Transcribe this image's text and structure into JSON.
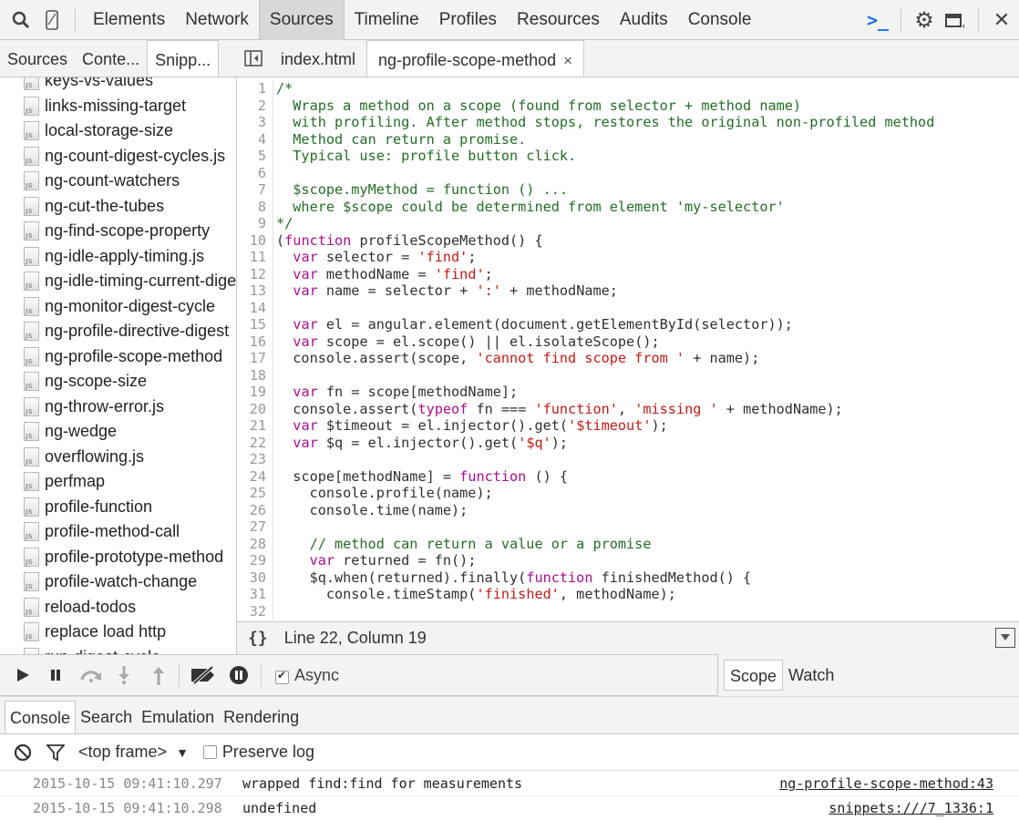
{
  "toolbar": {
    "tabs": [
      "Elements",
      "Network",
      "Sources",
      "Timeline",
      "Profiles",
      "Resources",
      "Audits",
      "Console"
    ],
    "active_tab": "Sources",
    "icons": [
      "search-icon",
      "device-mode-icon",
      "console-prompt-icon",
      "gear-icon",
      "dock-icon",
      "close-icon"
    ]
  },
  "navigator": {
    "tabs": [
      "Sources",
      "Conte...",
      "Snipp..."
    ],
    "active_tab": "Snipp...",
    "files": [
      "keys-vs-values",
      "links-missing-target",
      "local-storage-size",
      "ng-count-digest-cycles.js",
      "ng-count-watchers",
      "ng-cut-the-tubes",
      "ng-find-scope-property",
      "ng-idle-apply-timing.js",
      "ng-idle-timing-current-digest",
      "ng-monitor-digest-cycle",
      "ng-profile-directive-digest",
      "ng-profile-scope-method",
      "ng-scope-size",
      "ng-throw-error.js",
      "ng-wedge",
      "overflowing.js",
      "perfmap",
      "profile-function",
      "profile-method-call",
      "profile-prototype-method",
      "profile-watch-change",
      "reload-todos",
      "replace load http",
      "run-digest-cycle"
    ]
  },
  "editor": {
    "tabs": [
      {
        "label": "index.html",
        "active": false
      },
      {
        "label": "ng-profile-scope-method",
        "active": true,
        "close": "×"
      }
    ],
    "status": "Line 22, Column 19",
    "format_label": "{}",
    "lines": [
      [
        [
          "c",
          "/*"
        ]
      ],
      [
        [
          "c",
          "  Wraps a method on a scope (found from selector + method name)"
        ]
      ],
      [
        [
          "c",
          "  with profiling. After method stops, restores the original non-profiled method"
        ]
      ],
      [
        [
          "c",
          "  Method can return a promise."
        ]
      ],
      [
        [
          "c",
          "  Typical use: profile button click."
        ]
      ],
      [
        [
          "p",
          ""
        ]
      ],
      [
        [
          "c",
          "  $scope.myMethod = function () ..."
        ]
      ],
      [
        [
          "c",
          "  where $scope could be determined from element 'my-selector'"
        ]
      ],
      [
        [
          "c",
          "*/"
        ]
      ],
      [
        [
          "p",
          "("
        ],
        [
          "k",
          "function"
        ],
        [
          "p",
          " profileScopeMethod() {"
        ]
      ],
      [
        [
          "p",
          "  "
        ],
        [
          "k",
          "var"
        ],
        [
          "p",
          " selector = "
        ],
        [
          "s",
          "'find'"
        ],
        [
          "p",
          ";"
        ]
      ],
      [
        [
          "p",
          "  "
        ],
        [
          "k",
          "var"
        ],
        [
          "p",
          " methodName = "
        ],
        [
          "s",
          "'find'"
        ],
        [
          "p",
          ";"
        ]
      ],
      [
        [
          "p",
          "  "
        ],
        [
          "k",
          "var"
        ],
        [
          "p",
          " name = selector + "
        ],
        [
          "s",
          "':'"
        ],
        [
          "p",
          " + methodName;"
        ]
      ],
      [
        [
          "p",
          ""
        ]
      ],
      [
        [
          "p",
          "  "
        ],
        [
          "k",
          "var"
        ],
        [
          "p",
          " el = angular.element(document.getElementById(selector));"
        ]
      ],
      [
        [
          "p",
          "  "
        ],
        [
          "k",
          "var"
        ],
        [
          "p",
          " scope = el.scope() || el.isolateScope();"
        ]
      ],
      [
        [
          "p",
          "  console.assert(scope, "
        ],
        [
          "s",
          "'cannot find scope from '"
        ],
        [
          "p",
          " + name);"
        ]
      ],
      [
        [
          "p",
          ""
        ]
      ],
      [
        [
          "p",
          "  "
        ],
        [
          "k",
          "var"
        ],
        [
          "p",
          " fn = scope[methodName];"
        ]
      ],
      [
        [
          "p",
          "  console.assert("
        ],
        [
          "k",
          "typeof"
        ],
        [
          "p",
          " fn === "
        ],
        [
          "s",
          "'function'"
        ],
        [
          "p",
          ", "
        ],
        [
          "s",
          "'missing '"
        ],
        [
          "p",
          " + methodName);"
        ]
      ],
      [
        [
          "p",
          "  "
        ],
        [
          "k",
          "var"
        ],
        [
          "p",
          " $timeout = el.injector().get("
        ],
        [
          "s",
          "'$timeout'"
        ],
        [
          "p",
          ");"
        ]
      ],
      [
        [
          "p",
          "  "
        ],
        [
          "k",
          "var"
        ],
        [
          "p",
          " $q = el.injector().get("
        ],
        [
          "s",
          "'$q'"
        ],
        [
          "p",
          ");"
        ]
      ],
      [
        [
          "p",
          ""
        ]
      ],
      [
        [
          "p",
          "  scope[methodName] = "
        ],
        [
          "k",
          "function"
        ],
        [
          "p",
          " () {"
        ]
      ],
      [
        [
          "p",
          "    console.profile(name);"
        ]
      ],
      [
        [
          "p",
          "    console.time(name);"
        ]
      ],
      [
        [
          "p",
          ""
        ]
      ],
      [
        [
          "c",
          "    // method can return a value or a promise"
        ]
      ],
      [
        [
          "p",
          "    "
        ],
        [
          "k",
          "var"
        ],
        [
          "p",
          " returned = fn();"
        ]
      ],
      [
        [
          "p",
          "    $q.when(returned).finally("
        ],
        [
          "k",
          "function"
        ],
        [
          "p",
          " finishedMethod() {"
        ]
      ],
      [
        [
          "p",
          "      console.timeStamp("
        ],
        [
          "s",
          "'finished'"
        ],
        [
          "p",
          ", methodName);"
        ]
      ],
      [
        [
          "p",
          ""
        ]
      ]
    ]
  },
  "debugger": {
    "async_label": "Async",
    "async_checked": true,
    "sidebar_tabs": [
      "Scope",
      "Watch"
    ],
    "active_sidebar_tab": "Scope"
  },
  "drawer": {
    "tabs": [
      "Console",
      "Search",
      "Emulation",
      "Rendering"
    ],
    "active_tab": "Console",
    "frame_label": "<top frame>",
    "preserve_log_label": "Preserve log",
    "messages": [
      {
        "time": "2015-10-15 09:41:10.297",
        "text": "wrapped find:find for measurements",
        "source": "ng-profile-scope-method:43"
      },
      {
        "time": "2015-10-15 09:41:10.298",
        "text": "undefined",
        "source": "snippets:///7_1336:1"
      }
    ]
  },
  "colors": {
    "accent": "#1a73e8",
    "comment": "#236e25",
    "keyword": "#aa0d91",
    "string": "#c41a16"
  }
}
